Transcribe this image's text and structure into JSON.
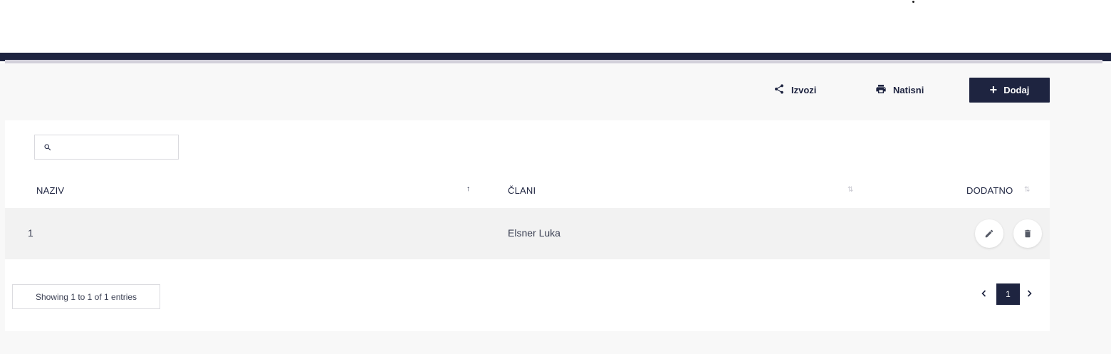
{
  "toolbar": {
    "export_label": "Izvozi",
    "print_label": "Natisni",
    "add_label": "Dodaj"
  },
  "search": {
    "value": "",
    "placeholder": ""
  },
  "table": {
    "columns": [
      "NAZIV",
      "ČLANI",
      "DODATNO"
    ],
    "sort": {
      "column": "NAZIV",
      "direction": "ascending"
    },
    "rows": [
      {
        "naziv": "1",
        "clani": "Elsner Luka"
      }
    ]
  },
  "footer": {
    "info": "Showing 1 to 1 of 1 entries",
    "current_page": "1"
  },
  "colors": {
    "primary": "#1e2440",
    "row_bg": "#f2f2f2",
    "page_bg": "#f8f8f8"
  }
}
